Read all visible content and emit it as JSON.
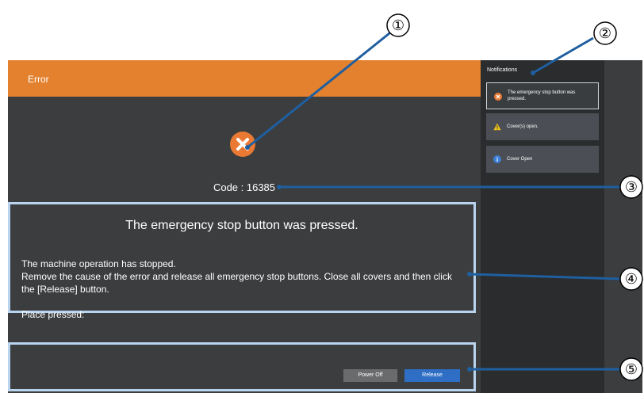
{
  "window": {
    "title": "Error"
  },
  "error": {
    "code_text": "Code : 16385",
    "message_title": "The emergency stop button was pressed.",
    "message_lines": [
      "The machine operation has stopped.",
      "Remove the cause of the error and release all emergency stop buttons. Close all covers and then click",
      "the [Release] button.",
      "Place pressed:"
    ]
  },
  "buttons": {
    "power_off": "Power Off",
    "release": "Release"
  },
  "notifications": {
    "header": "Notifications",
    "items": [
      {
        "text": "The emergency stop button was pressed.",
        "icon": "error-icon",
        "selected": true
      },
      {
        "text": "Cover(s) open.",
        "icon": "warning-icon",
        "selected": false
      },
      {
        "text": "Cover Open",
        "icon": "info-icon",
        "selected": false
      }
    ]
  },
  "callouts": [
    "①",
    "②",
    "③",
    "④",
    "⑤"
  ],
  "colors": {
    "title_bar": "#e3812e",
    "background": "#3b3d3f",
    "highlight_border": "#b9d4ef",
    "release_button": "#2e6ec5",
    "callout_line": "#1f5fa0"
  }
}
